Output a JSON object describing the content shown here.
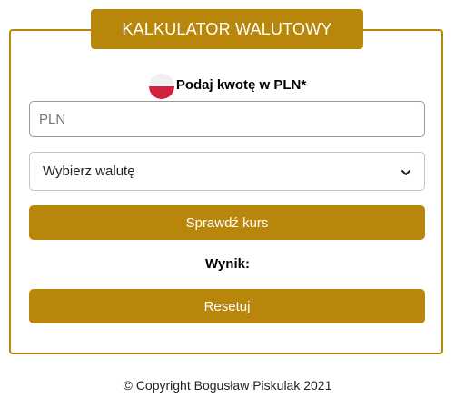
{
  "calculator": {
    "title": "KALKULATOR WALUTOWY",
    "amount_label": "Podaj kwotę w PLN*",
    "amount_placeholder": "PLN",
    "amount_value": "",
    "currency_select": {
      "selected": "Wybierz walutę"
    },
    "check_button_label": "Sprawdź kurs",
    "result_label": "Wynik:",
    "reset_button_label": "Resetuj"
  },
  "footer": {
    "copyright": "© Copyright Bogusław Piskulak 2021"
  },
  "icons": {
    "flag": "poland-flag-icon",
    "select_arrow": "chevron-down-icon"
  },
  "colors": {
    "accent": "#b8860b",
    "flag_white": "#f0f0f0",
    "flag_red": "#d4213d"
  }
}
